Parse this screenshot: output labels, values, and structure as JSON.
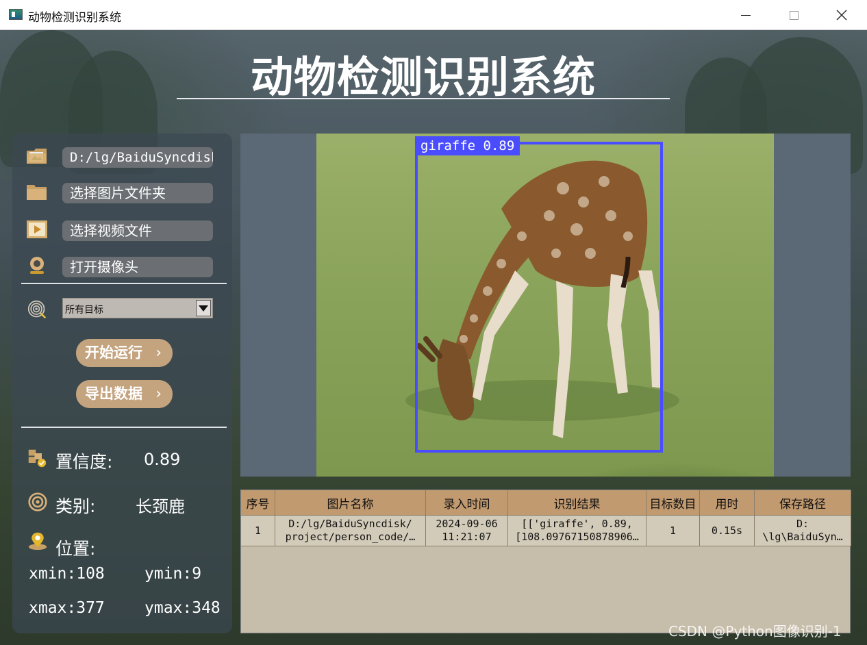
{
  "window": {
    "title": "动物检测识别系统"
  },
  "header": {
    "title": "动物检测识别系统"
  },
  "sidebar": {
    "path_value": "D:/lg/BaiduSyncdisk",
    "select_folder_label": "选择图片文件夹",
    "select_video_label": "选择视频文件",
    "open_camera_label": "打开摄像头",
    "target_select": {
      "value": "所有目标"
    },
    "run_label": "开始运行",
    "export_label": "导出数据",
    "chevron": "›"
  },
  "info": {
    "confidence_label": "置信度:",
    "confidence_value": "0.89",
    "class_label": "类别:",
    "class_value": "长颈鹿",
    "position_label": "位置:",
    "xmin": "xmin:108",
    "ymin": "ymin:9",
    "xmax": "xmax:377",
    "ymax": "ymax:348"
  },
  "detection": {
    "label": "giraffe 0.89",
    "box_color": "#4a4dff"
  },
  "table": {
    "headers": [
      "序号",
      "图片名称",
      "录入时间",
      "识别结果",
      "目标数目",
      "用时",
      "保存路径"
    ],
    "rows": [
      {
        "index": "1",
        "name_line1": "D:/lg/BaiduSyncdisk/",
        "name_line2": "project/person_code/…",
        "time_line1": "2024-09-06",
        "time_line2": "11:21:07",
        "result_line1": "[['giraffe', 0.89,",
        "result_line2": "[108.09767150878906…",
        "count": "1",
        "duration": "0.15s",
        "path_line1": "D:",
        "path_line2": "\\lg\\BaiduSyn…"
      }
    ]
  },
  "colors": {
    "accent_button": "#c4a37f",
    "table_header": "#c19a70",
    "bbox": "#4a4dff"
  },
  "watermark": "CSDN @Python图像识别-1"
}
